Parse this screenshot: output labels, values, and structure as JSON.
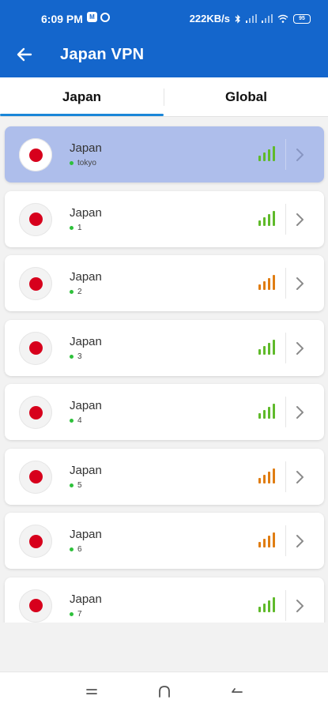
{
  "status": {
    "time": "6:09 PM",
    "speed": "222KB/s",
    "battery": "95"
  },
  "header": {
    "title": "Japan VPN"
  },
  "tabs": [
    {
      "label": "Japan",
      "active": true
    },
    {
      "label": "Global",
      "active": false
    }
  ],
  "colors": {
    "brand": "#1466cc",
    "selected_row": "#aebeeb",
    "signal_good": "#5fba2a",
    "signal_medium": "#e07d12",
    "online_dot": "#2ec13b",
    "flag_red": "#d7001c"
  },
  "servers": [
    {
      "country": "Japan",
      "location": "tokyo",
      "signal": "good",
      "selected": true
    },
    {
      "country": "Japan",
      "location": "1",
      "signal": "good",
      "selected": false
    },
    {
      "country": "Japan",
      "location": "2",
      "signal": "medium",
      "selected": false
    },
    {
      "country": "Japan",
      "location": "3",
      "signal": "good",
      "selected": false
    },
    {
      "country": "Japan",
      "location": "4",
      "signal": "good",
      "selected": false
    },
    {
      "country": "Japan",
      "location": "5",
      "signal": "medium",
      "selected": false
    },
    {
      "country": "Japan",
      "location": "6",
      "signal": "medium",
      "selected": false
    },
    {
      "country": "Japan",
      "location": "7",
      "signal": "good",
      "selected": false
    }
  ],
  "icons": {
    "back": "arrow-left-icon",
    "chevron": "chevron-right-icon",
    "signal": "signal-bars-icon",
    "flag": "japan-flag-icon",
    "nav_recents": "menu-lines-icon",
    "nav_home": "home-arch-icon",
    "nav_back": "back-arrow-icon"
  }
}
